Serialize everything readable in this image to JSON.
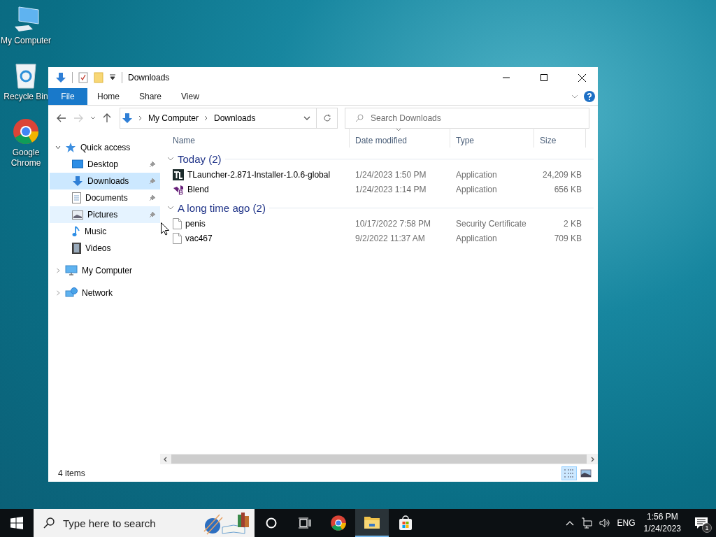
{
  "desktop_icons": [
    {
      "label": "My Computer",
      "kind": "computer"
    },
    {
      "label": "Recycle Bin",
      "kind": "recycle"
    },
    {
      "label": "Google Chrome",
      "kind": "chrome"
    }
  ],
  "window": {
    "title": "Downloads",
    "ribbon_tabs": [
      {
        "label": "File",
        "selected": true
      },
      {
        "label": "Home",
        "selected": false
      },
      {
        "label": "Share",
        "selected": false
      },
      {
        "label": "View",
        "selected": false
      }
    ],
    "address_path": [
      "My Computer",
      "Downloads"
    ],
    "search": {
      "placeholder": "Search Downloads"
    },
    "nav": [
      {
        "label": "Quick access",
        "kind": "star",
        "expanded": true,
        "selected": false,
        "hovered": false,
        "children": [
          {
            "label": "Desktop",
            "kind": "desktop",
            "pinned": true,
            "selected": false,
            "hovered": false
          },
          {
            "label": "Downloads",
            "kind": "download",
            "pinned": true,
            "selected": true,
            "hovered": false
          },
          {
            "label": "Documents",
            "kind": "document",
            "pinned": true,
            "selected": false,
            "hovered": false
          },
          {
            "label": "Pictures",
            "kind": "picture",
            "pinned": true,
            "selected": false,
            "hovered": true
          },
          {
            "label": "Music",
            "kind": "music",
            "pinned": false,
            "selected": false,
            "hovered": false
          },
          {
            "label": "Videos",
            "kind": "video",
            "pinned": false,
            "selected": false,
            "hovered": false
          }
        ]
      },
      {
        "label": "My Computer",
        "kind": "computer",
        "expanded": false,
        "selected": false,
        "hovered": false
      },
      {
        "label": "Network",
        "kind": "network",
        "expanded": false,
        "selected": false,
        "hovered": false
      }
    ],
    "columns": [
      {
        "label": "Name",
        "sorted": false
      },
      {
        "label": "Date modified",
        "sorted": true
      },
      {
        "label": "Type",
        "sorted": false
      },
      {
        "label": "Size",
        "sorted": false
      }
    ],
    "groups": [
      {
        "label": "Today (2)",
        "expanded": true,
        "rows": [
          {
            "name": "TLauncher-2.871-Installer-1.0.6-global",
            "date": "1/24/2023 1:50 PM",
            "type": "Application",
            "size": "24,209 KB",
            "kind": "tlauncher"
          },
          {
            "name": "Blend",
            "date": "1/24/2023 1:14 PM",
            "type": "Application",
            "size": "656 KB",
            "kind": "blend"
          }
        ]
      },
      {
        "label": "A long time ago (2)",
        "expanded": true,
        "rows": [
          {
            "name": "penis",
            "date": "10/17/2022 7:58 PM",
            "type": "Security Certificate",
            "size": "2 KB",
            "kind": "file"
          },
          {
            "name": "vac467",
            "date": "9/2/2022 11:37 AM",
            "type": "Application",
            "size": "709 KB",
            "kind": "file"
          }
        ]
      }
    ],
    "status": "4 items",
    "views": [
      {
        "kind": "details",
        "selected": true
      },
      {
        "kind": "tiles",
        "selected": false
      }
    ]
  },
  "taskbar": {
    "search_placeholder": "Type here to search",
    "apps": [
      {
        "kind": "chrome",
        "active": false
      },
      {
        "kind": "explorer",
        "active": true
      },
      {
        "kind": "store",
        "active": false
      }
    ],
    "language": "ENG",
    "time": "1:56 PM",
    "date": "1/24/2023",
    "notification_count": "1"
  }
}
